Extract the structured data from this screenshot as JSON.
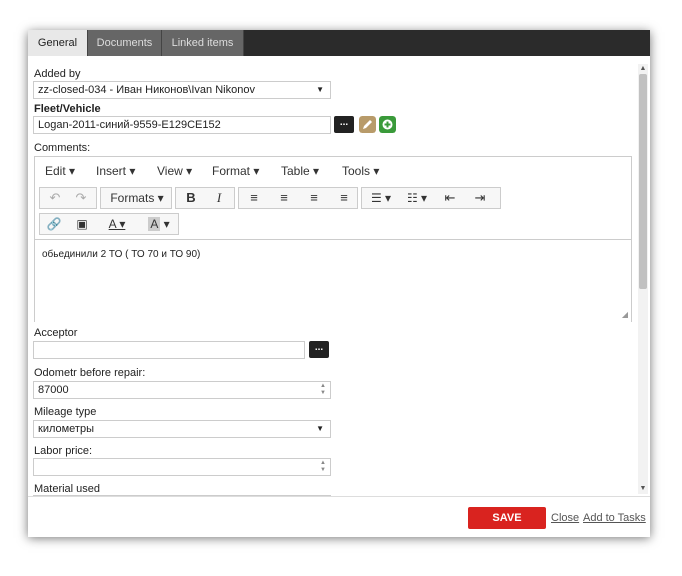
{
  "tabs": [
    "General",
    "Documents",
    "Linked items"
  ],
  "added_by": {
    "label": "Added by",
    "value": "zz-closed-034 - Иван Никонов\\Ivan Nikonov"
  },
  "vehicle": {
    "label": "Fleet/Vehicle",
    "value": "Logan-2011-синий-9559-E129CE152",
    "browse": "..."
  },
  "comments": {
    "label": "Comments:",
    "menus": [
      "Edit ▾",
      "Insert ▾",
      "View ▾",
      "Format ▾",
      "Table ▾",
      "Tools ▾"
    ],
    "formats": "Formats ▾",
    "text": "обьединили 2 ТО ( ТО 70 и ТО 90)"
  },
  "acceptor": {
    "label": "Acceptor",
    "value": "",
    "browse": "..."
  },
  "odometer": {
    "label": "Odometr before repair:",
    "value": "87000"
  },
  "mileage": {
    "label": "Mileage type",
    "value": "километры"
  },
  "labor": {
    "label": "Labor price:",
    "value": ""
  },
  "material": {
    "label": "Material used"
  },
  "footer": {
    "save": "SAVE",
    "close": "Close",
    "add": "Add to Tasks"
  },
  "colors": {
    "save": "#d9231f",
    "tabbar": "#2b2b2b",
    "edit_icon": "#b89b6a",
    "add_icon": "#3a9a3a"
  }
}
